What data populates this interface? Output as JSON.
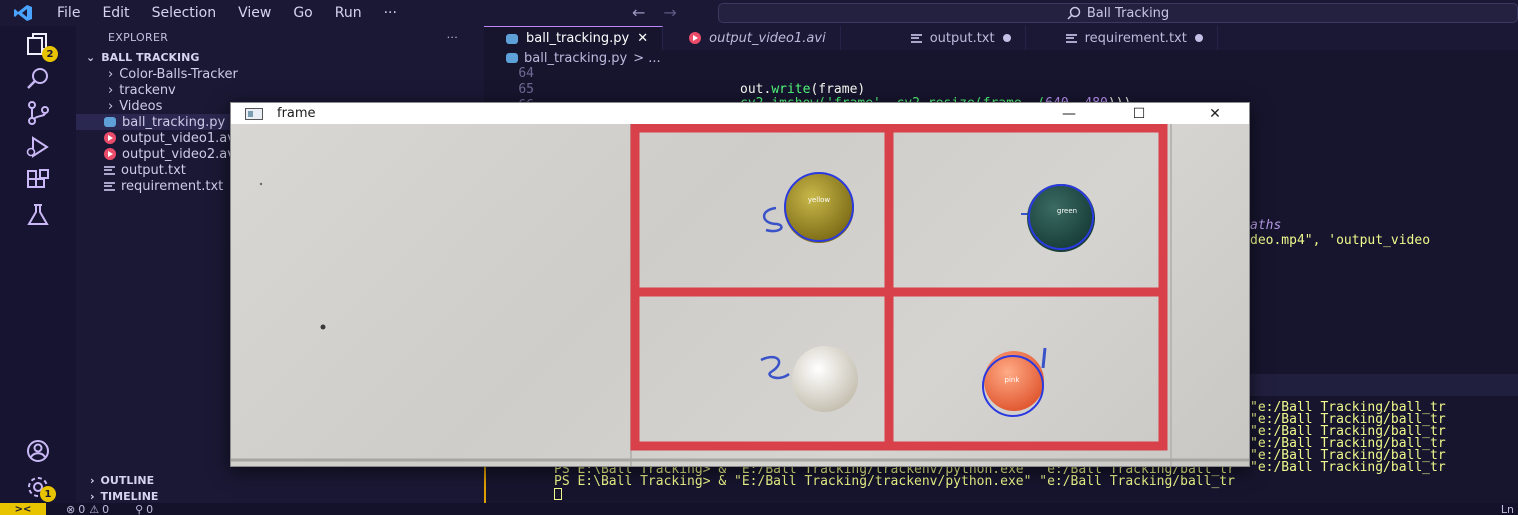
{
  "titlebar": {
    "menu": [
      "File",
      "Edit",
      "Selection",
      "View",
      "Go",
      "Run"
    ],
    "more": "···",
    "search": "Ball Tracking"
  },
  "activity": {
    "explorer_badge": "2",
    "settings_badge": "1"
  },
  "sidebar": {
    "header": "EXPLORER",
    "header_more": "···",
    "root": "BALL TRACKING",
    "items": [
      {
        "label": "Color-Balls-Tracker",
        "type": "folder"
      },
      {
        "label": "trackenv",
        "type": "folder"
      },
      {
        "label": "Videos",
        "type": "folder"
      },
      {
        "label": "ball_tracking.py",
        "type": "py"
      },
      {
        "label": "output_video1.avi",
        "type": "avi"
      },
      {
        "label": "output_video2.avi",
        "type": "avi"
      },
      {
        "label": "output.txt",
        "type": "txt"
      },
      {
        "label": "requirement.txt",
        "type": "txt"
      }
    ],
    "outline": "OUTLINE",
    "timeline": "TIMELINE"
  },
  "tabs": [
    {
      "label": "ball_tracking.py",
      "active": true
    },
    {
      "label": "output_video1.avi",
      "active": false
    },
    {
      "label": "output.txt",
      "active": false
    },
    {
      "label": "requirement.txt",
      "active": false
    }
  ],
  "breadcrumb": {
    "file": "ball_tracking.py",
    "rest": "> ..."
  },
  "editor": {
    "line_numbers": [
      "64",
      "65",
      "66"
    ],
    "code_line_65_obj": "out.",
    "code_line_65_fn": "write",
    "code_line_65_rest": "(frame)",
    "code_line_66_a": "cv2.imshow('frame', cv2.resize(frame, (",
    "code_line_66_n1": "640",
    "code_line_66_sep": ", ",
    "code_line_66_n2": "480",
    "code_line_66_end": ")))",
    "comment_tail": "aths",
    "paths_tail_a": "deo.mp4\",",
    "paths_tail_b": "'output_video"
  },
  "terminal": {
    "right_lines": [
      "\"e:/Ball Tracking/ball_tr",
      "\"e:/Ball Tracking/ball_tr",
      "\"e:/Ball Tracking/ball_tr",
      "\"e:/Ball Tracking/ball_tr",
      "\"e:/Ball Tracking/ball_tr",
      "\"e:/Ball Tracking/ball_tr",
      "\"e:/Ball Tracking/ball_tr"
    ],
    "prompt_line_a": "PS E:\\Ball Tracking> & \"E:/Ball Tracking/trackenv/python.exe\" \"e:/Ball Tracking/ball_tr",
    "prompt_line_b": "PS E:\\Ball Tracking> & \"E:/Ball Tracking/trackenv/python.exe\" \"e:/Ball Tracking/ball_tr"
  },
  "statusbar": {
    "remote": "><",
    "errors": "0",
    "warnings": "0",
    "ports": "0",
    "right": "Ln"
  },
  "cv_window": {
    "title": "frame",
    "minimize": "—",
    "maximize": "☐",
    "close": "✕",
    "ball_labels": [
      "yellow",
      "green",
      "pink"
    ]
  },
  "colors": {
    "accent": "#bb86fc",
    "grid_red": "#d8414a",
    "circle_blue": "#2a3ae0"
  }
}
